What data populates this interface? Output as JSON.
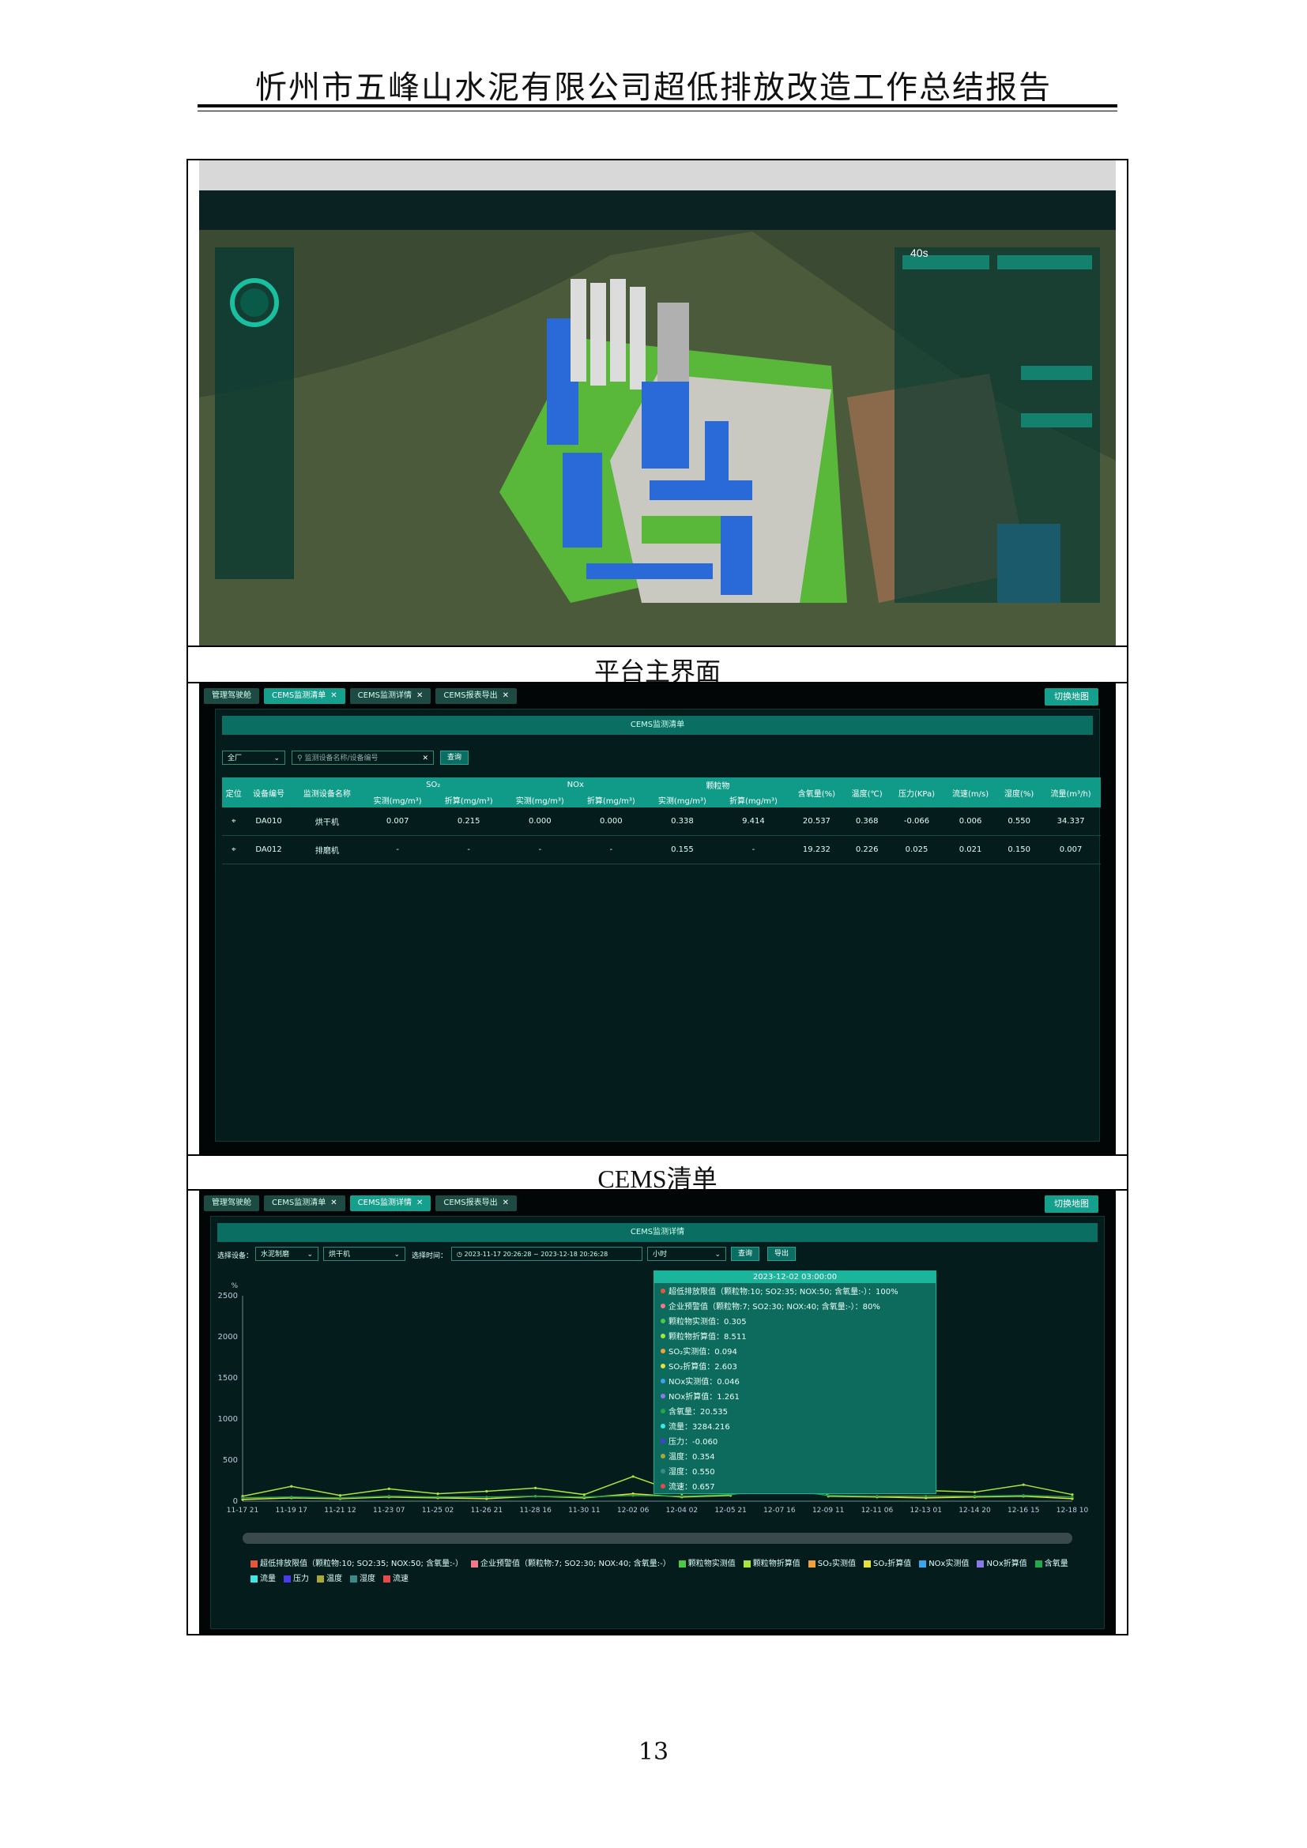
{
  "header": {
    "title": "忻州市五峰山水泥有限公司超低排放改造工作总结报告"
  },
  "panel1": {
    "caption": "平台主界面",
    "screen_overlay_text": "40s"
  },
  "panel2": {
    "caption": "CEMS清单",
    "tabs": [
      "管理驾驶舱",
      "CEMS监测清单",
      "CEMS监测详情",
      "CEMS报表导出"
    ],
    "active_tab": 1,
    "switch_label": "切换地图",
    "title": "CEMS监测清单",
    "filter": {
      "scope": "全厂",
      "search_placeholder": "监测设备名称/设备编号",
      "query_label": "查询"
    },
    "table": {
      "group_headers": [
        "SO₂",
        "NOx",
        "颗粒物"
      ],
      "cols": [
        "定位",
        "设备编号",
        "监测设备名称",
        "实测(mg/m³)",
        "折算(mg/m³)",
        "实测(mg/m³)",
        "折算(mg/m³)",
        "实测(mg/m³)",
        "折算(mg/m³)",
        "含氧量(%)",
        "温度(℃)",
        "压力(KPa)",
        "流速(m/s)",
        "湿度(%)",
        "流量(m³/h)"
      ],
      "rows": [
        [
          "DA010",
          "烘干机",
          "0.007",
          "0.215",
          "0.000",
          "0.000",
          "0.338",
          "9.414",
          "20.537",
          "0.368",
          "-0.066",
          "0.006",
          "0.550",
          "34.337"
        ],
        [
          "DA012",
          "排磨机",
          "-",
          "-",
          "-",
          "-",
          "0.155",
          "-",
          "19.232",
          "0.226",
          "0.025",
          "0.021",
          "0.150",
          "0.007"
        ]
      ]
    }
  },
  "panel3": {
    "tabs": [
      "管理驾驶舱",
      "CEMS监测清单",
      "CEMS监测详情",
      "CEMS报表导出"
    ],
    "active_tab": 2,
    "switch_label": "切换地图",
    "title": "CEMS监测详情",
    "filter": {
      "device_label": "选择设备：",
      "device1": "水泥制磨",
      "device2": "烘干机",
      "time_label": "选择时间：",
      "time_start": "2023-11-17 20:26:28",
      "time_sep": "~",
      "time_end": "2023-12-18 20:26:28",
      "granularity": "小时",
      "query_label": "查询",
      "export_label": "导出"
    },
    "tooltip": {
      "time": "2023-12-02 03:00:00",
      "items": [
        {
          "label": "超低排放限值（颗粒物:10; SO2:35; NOX:50; 含氧量:-）：100%",
          "color": "#e8543c"
        },
        {
          "label": "企业预警值（颗粒物:7; SO2:30; NOX:40; 含氧量:-）：80%",
          "color": "#f2788a"
        },
        {
          "label": "颗粒物实测值：0.305",
          "color": "#4bc94a"
        },
        {
          "label": "颗粒物折算值：8.511",
          "color": "#a8e63a"
        },
        {
          "label": "SO₂实测值：0.094",
          "color": "#f2a03a"
        },
        {
          "label": "SO₂折算值：2.603",
          "color": "#e8e03a"
        },
        {
          "label": "NOx实测值：0.046",
          "color": "#3aa4e8"
        },
        {
          "label": "NOx折算值：1.261",
          "color": "#8a7ae8"
        },
        {
          "label": "含氧量：20.535",
          "color": "#22a84a"
        },
        {
          "label": "流量：3284.216",
          "color": "#3ae8e8"
        },
        {
          "label": "压力：-0.060",
          "color": "#4a3ae8"
        },
        {
          "label": "温度：0.354",
          "color": "#a8a83a"
        },
        {
          "label": "湿度：0.550",
          "color": "#3a8a8a"
        },
        {
          "label": "流速：0.657",
          "color": "#e84a4a"
        }
      ]
    },
    "legend": [
      {
        "label": "超低排放限值（颗粒物:10; SO2:35; NOX:50; 含氧量:-）",
        "color": "#e8543c"
      },
      {
        "label": "企业预警值（颗粒物:7; SO2:30; NOX:40; 含氧量:-）",
        "color": "#f2788a"
      },
      {
        "label": "颗粒物实测值",
        "color": "#4bc94a"
      },
      {
        "label": "颗粒物折算值",
        "color": "#a8e63a"
      },
      {
        "label": "SO₂实测值",
        "color": "#f2a03a"
      },
      {
        "label": "SO₂折算值",
        "color": "#e8e03a"
      },
      {
        "label": "NOx实测值",
        "color": "#3aa4e8"
      },
      {
        "label": "NOx折算值",
        "color": "#8a7ae8"
      },
      {
        "label": "含氧量",
        "color": "#22a84a"
      },
      {
        "label": "流量",
        "color": "#3ae8e8"
      },
      {
        "label": "压力",
        "color": "#4a3ae8"
      },
      {
        "label": "温度",
        "color": "#a8a83a"
      },
      {
        "label": "湿度",
        "color": "#3a8a8a"
      },
      {
        "label": "流速",
        "color": "#e84a4a"
      }
    ]
  },
  "chart_data": {
    "type": "line",
    "ylabel": "%",
    "ylim": [
      0,
      2500
    ],
    "yticks": [
      0,
      500,
      1000,
      1500,
      2000,
      2500
    ],
    "x": [
      "11-17 21",
      "11-19 17",
      "11-21 12",
      "11-23 07",
      "11-25 02",
      "11-26 21",
      "11-28 16",
      "11-30 11",
      "12-02 06",
      "12-04 02",
      "12-05 21",
      "12-07 16",
      "12-09 11",
      "12-11 06",
      "12-13 01",
      "12-14 20",
      "12-16 15",
      "12-18 10"
    ],
    "series": [
      {
        "name": "颗粒物折算值",
        "color": "#a8e63a",
        "values": [
          60,
          180,
          70,
          150,
          90,
          120,
          160,
          80,
          300,
          90,
          200,
          650,
          140,
          180,
          130,
          110,
          200,
          80
        ]
      },
      {
        "name": "SO₂折算值",
        "color": "#e8e03a",
        "values": [
          20,
          40,
          30,
          50,
          40,
          30,
          60,
          40,
          90,
          50,
          70,
          900,
          60,
          50,
          40,
          50,
          60,
          30
        ]
      },
      {
        "name": "含氧量",
        "color": "#22a84a",
        "values": [
          40,
          50,
          40,
          60,
          50,
          50,
          60,
          50,
          70,
          60,
          80,
          150,
          70,
          60,
          60,
          60,
          70,
          50
        ]
      }
    ]
  },
  "page": {
    "number": "13"
  }
}
